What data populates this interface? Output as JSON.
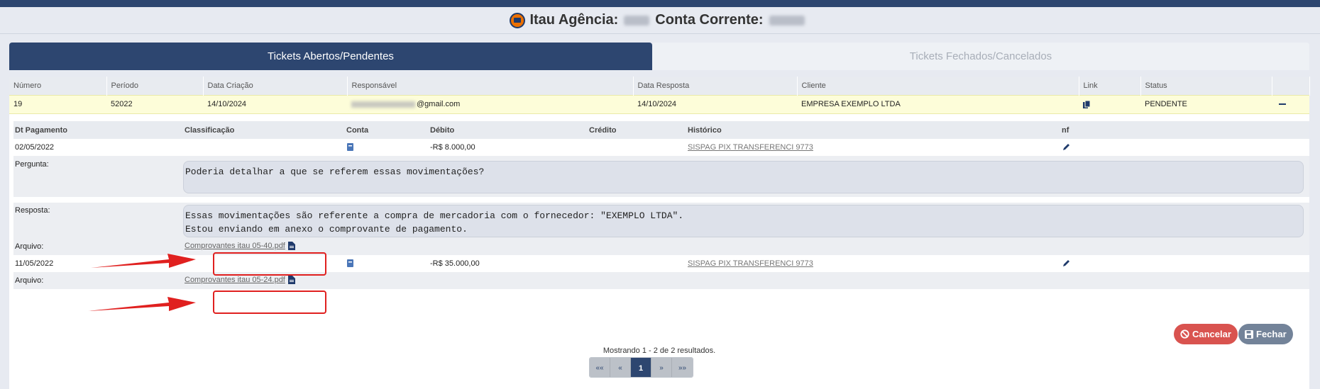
{
  "header": {
    "bank_label": "Itau Agência:",
    "account_label": "Conta Corrente:"
  },
  "tabs": [
    {
      "label": "Tickets Abertos/Pendentes",
      "active": true
    },
    {
      "label": "Tickets Fechados/Cancelados",
      "active": false
    }
  ],
  "tickets_table": {
    "headers": [
      "Número",
      "Período",
      "Data Criação",
      "Responsável",
      "Data Resposta",
      "Cliente",
      "Link",
      "Status",
      ""
    ],
    "row": {
      "numero": "19",
      "periodo": "52022",
      "data_criacao": "14/10/2024",
      "responsavel_suffix": "@gmail.com",
      "data_resposta": "14/10/2024",
      "cliente": "EMPRESA EXEMPLO LTDA",
      "link_icon": "copy-icon",
      "status": "PENDENTE"
    }
  },
  "movements": {
    "headers": [
      "Dt Pagamento",
      "Classificação",
      "Conta",
      "Débito",
      "Crédito",
      "Histórico",
      "nf"
    ],
    "items": [
      {
        "dt_pagamento": "02/05/2022",
        "debito": "-R$ 8.000,00",
        "historico": "SISPAG PIX TRANSFERENCI 9773",
        "pergunta_label": "Pergunta:",
        "pergunta": "Poderia detalhar a que se referem essas movimentações?",
        "resposta_label": "Resposta:",
        "resposta": "Essas movimentações são referente a compra de mercadoria com o fornecedor: \"EXEMPLO LTDA\".\nEstou enviando em anexo o comprovante de pagamento.",
        "arquivo_label": "Arquivo:",
        "arquivo": "Comprovantes itau 05-40.pdf"
      },
      {
        "dt_pagamento": "11/05/2022",
        "debito": "-R$ 35.000,00",
        "historico": "SISPAG PIX TRANSFERENCI 9773",
        "arquivo_label": "Arquivo:",
        "arquivo": "Comprovantes itau 05-24.pdf"
      }
    ]
  },
  "actions": {
    "cancel": "Cancelar",
    "close": "Fechar"
  },
  "pagination": {
    "info": "Mostrando 1 - 2 de 2 resultados.",
    "first": "««",
    "prev": "«",
    "current": "1",
    "next": "»",
    "last": "»»"
  },
  "colors": {
    "primary": "#2d4670",
    "highlight_row": "#fdfdd9",
    "danger": "#d9534f",
    "annotation_red": "#e0201f"
  }
}
